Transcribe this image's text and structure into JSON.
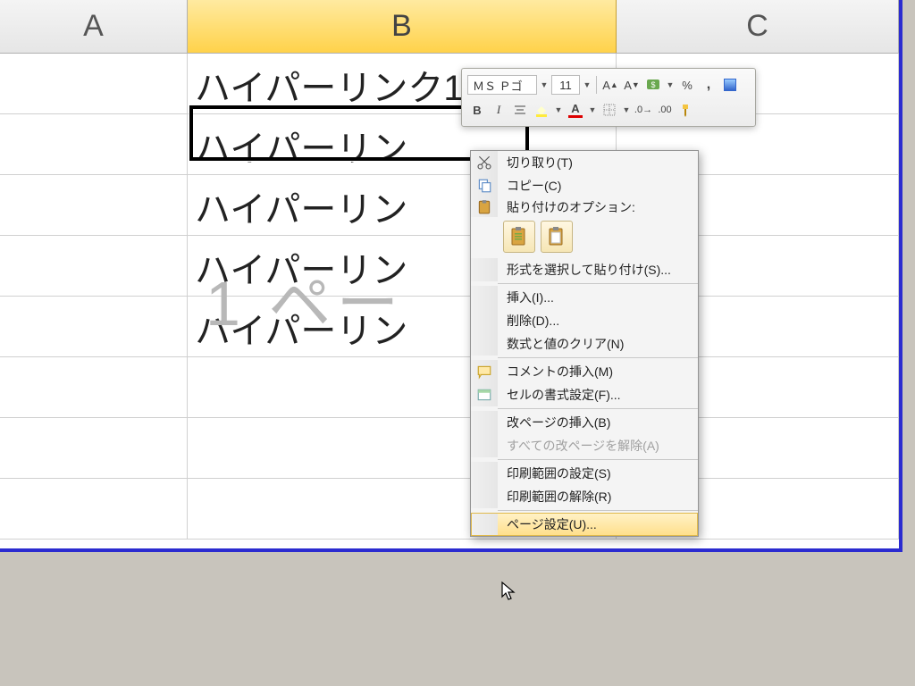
{
  "columns": {
    "A": "A",
    "B": "B",
    "C": "C"
  },
  "cells": {
    "b1": "ハイパーリンク1",
    "b2": "ハイパーリン",
    "b3": "ハイパーリン",
    "b4": "ハイパーリン",
    "b5": "ハイパーリン"
  },
  "watermark": "1 ペー",
  "mini_toolbar": {
    "font_name": "ＭＳ Ｐゴ",
    "font_size": "11",
    "percent_symbol": "%",
    "comma": ","
  },
  "context_menu": {
    "cut": "切り取り(T)",
    "copy": "コピー(C)",
    "paste_options_label": "貼り付けのオプション:",
    "paste_special": "形式を選択して貼り付け(S)...",
    "insert": "挿入(I)...",
    "delete": "削除(D)...",
    "clear": "数式と値のクリア(N)",
    "insert_comment": "コメントの挿入(M)",
    "format_cells": "セルの書式設定(F)...",
    "insert_page_break": "改ページの挿入(B)",
    "reset_page_breaks": "すべての改ページを解除(A)",
    "set_print_area": "印刷範囲の設定(S)",
    "clear_print_area": "印刷範囲の解除(R)",
    "page_setup": "ページ設定(U)..."
  }
}
